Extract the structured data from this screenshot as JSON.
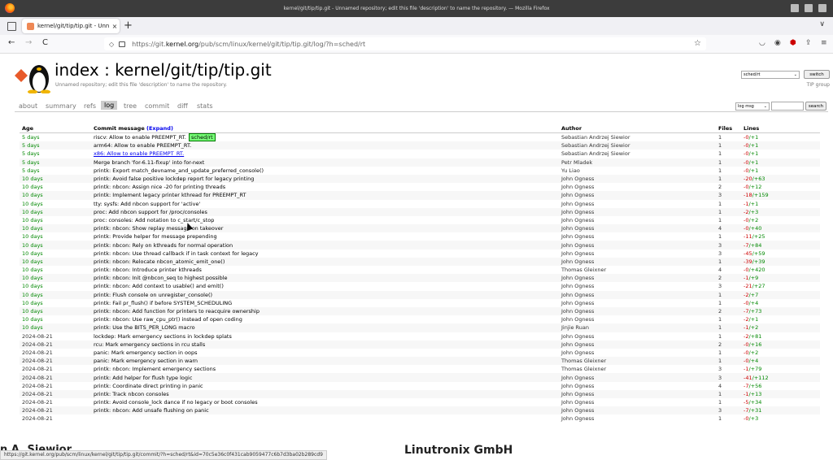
{
  "window": {
    "title": "kernel/git/tip/tip.git - Unnamed repository; edit this file 'description' to name the repository. — Mozilla Firefox"
  },
  "tab": {
    "title": "kernel/git/tip/tip.git - Unn",
    "close": "×",
    "new": "+"
  },
  "nav": {
    "back": "←",
    "forward": "→",
    "reload": "C",
    "url_prefix": "https://git.",
    "url_host": "kernel.org",
    "url_path": "/pub/scm/linux/kernel/git/tip/tip.git/log/?h=sched/rt",
    "bookmark": "☆"
  },
  "repo": {
    "title": "index : kernel/git/tip/tip.git",
    "description": "Unnamed repository; edit this file 'description' to name the repository.",
    "branch": "sched/rt",
    "switch_label": "switch",
    "group": "TIP group"
  },
  "tabs": [
    "about",
    "summary",
    "refs",
    "log",
    "tree",
    "commit",
    "diff",
    "stats"
  ],
  "active_tab": "log",
  "search": {
    "mode": "log msg",
    "button": "search"
  },
  "table": {
    "headers": {
      "age": "Age",
      "message": "Commit message",
      "expand": "(Expand)",
      "author": "Author",
      "files": "Files",
      "lines": "Lines"
    },
    "rows": [
      {
        "age": "5 days",
        "msg": "riscv: Allow to enable PREEMPT_RT.",
        "badge": "sched/rt",
        "author": "Sebastian Andrzej Siewior",
        "files": "1",
        "del": "-0",
        "add": "/+1"
      },
      {
        "age": "5 days",
        "msg": "arm64: Allow to enable PREEMPT_RT.",
        "author": "Sebastian Andrzej Siewior",
        "files": "1",
        "del": "-0",
        "add": "/+1"
      },
      {
        "age": "5 days",
        "msg": "x86: Allow to enable PREEMPT_RT.",
        "hl": true,
        "author": "Sebastian Andrzej Siewior",
        "files": "1",
        "del": "-0",
        "add": "/+1"
      },
      {
        "age": "5 days",
        "msg": "Merge branch 'for-6.11-fixup' into for-next",
        "author": "Petr Mladek",
        "files": "1",
        "del": "-0",
        "add": "/+1"
      },
      {
        "age": "5 days",
        "msg": "printk: Export match_devname_and_update_preferred_console()",
        "author": "Yu Liao",
        "files": "1",
        "del": "-0",
        "add": "/+1"
      },
      {
        "age": "10 days",
        "msg": "printk: Avoid false positive lockdep report for legacy printing",
        "author": "John Ogness",
        "files": "1",
        "del": "-20",
        "add": "/+63"
      },
      {
        "age": "10 days",
        "msg": "printk: nbcon: Assign nice -20 for printing threads",
        "author": "John Ogness",
        "files": "2",
        "del": "-0",
        "add": "/+12"
      },
      {
        "age": "10 days",
        "msg": "printk: Implement legacy printer kthread for PREEMPT_RT",
        "author": "John Ogness",
        "files": "3",
        "del": "-18",
        "add": "/+159"
      },
      {
        "age": "10 days",
        "msg": "tty: sysfs: Add nbcon support for 'active'",
        "author": "John Ogness",
        "files": "1",
        "del": "-1",
        "add": "/+1"
      },
      {
        "age": "10 days",
        "msg": "proc: Add nbcon support for /proc/consoles",
        "author": "John Ogness",
        "files": "1",
        "del": "-2",
        "add": "/+3"
      },
      {
        "age": "10 days",
        "msg": "proc: consoles: Add notation to c_start/c_stop",
        "author": "John Ogness",
        "files": "1",
        "del": "-0",
        "add": "/+2"
      },
      {
        "age": "10 days",
        "msg": "printk: nbcon: Show replay message on takeover",
        "author": "John Ogness",
        "files": "4",
        "del": "-0",
        "add": "/+40"
      },
      {
        "age": "10 days",
        "msg": "printk: Provide helper for message prepending",
        "author": "John Ogness",
        "files": "1",
        "del": "-11",
        "add": "/+25"
      },
      {
        "age": "10 days",
        "msg": "printk: nbcon: Rely on kthreads for normal operation",
        "author": "John Ogness",
        "files": "3",
        "del": "-7",
        "add": "/+84"
      },
      {
        "age": "10 days",
        "msg": "printk: nbcon: Use thread callback if in task context for legacy",
        "author": "John Ogness",
        "files": "3",
        "del": "-45",
        "add": "/+59"
      },
      {
        "age": "10 days",
        "msg": "printk: nbcon: Relocate nbcon_atomic_emit_one()",
        "author": "John Ogness",
        "files": "1",
        "del": "-39",
        "add": "/+39"
      },
      {
        "age": "10 days",
        "msg": "printk: nbcon: Introduce printer kthreads",
        "author": "Thomas Gleixner",
        "files": "4",
        "del": "-0",
        "add": "/+420"
      },
      {
        "age": "10 days",
        "msg": "printk: nbcon: Init @nbcon_seq to highest possible",
        "author": "John Ogness",
        "files": "2",
        "del": "-1",
        "add": "/+9"
      },
      {
        "age": "10 days",
        "msg": "printk: nbcon: Add context to usable() and emit()",
        "author": "John Ogness",
        "files": "3",
        "del": "-21",
        "add": "/+27"
      },
      {
        "age": "10 days",
        "msg": "printk: Flush console on unregister_console()",
        "author": "John Ogness",
        "files": "1",
        "del": "-2",
        "add": "/+7"
      },
      {
        "age": "10 days",
        "msg": "printk: Fail pr_flush() if before SYSTEM_SCHEDULING",
        "author": "John Ogness",
        "files": "1",
        "del": "-0",
        "add": "/+4"
      },
      {
        "age": "10 days",
        "msg": "printk: nbcon: Add function for printers to reacquire ownership",
        "author": "John Ogness",
        "files": "2",
        "del": "-7",
        "add": "/+73"
      },
      {
        "age": "10 days",
        "msg": "printk: nbcon: Use raw_cpu_ptr() instead of open coding",
        "author": "John Ogness",
        "files": "1",
        "del": "-2",
        "add": "/+1"
      },
      {
        "age": "10 days",
        "msg": "printk: Use the BITS_PER_LONG macro",
        "author": "Jinjie Ruan",
        "files": "1",
        "del": "-1",
        "add": "/+2"
      },
      {
        "age": "2024-08-21",
        "old": true,
        "msg": "lockdep: Mark emergency sections in lockdep splats",
        "author": "John Ogness",
        "files": "1",
        "del": "-2",
        "add": "/+81"
      },
      {
        "age": "2024-08-21",
        "old": true,
        "msg": "rcu: Mark emergency sections in rcu stalls",
        "author": "John Ogness",
        "files": "2",
        "del": "-0",
        "add": "/+16"
      },
      {
        "age": "2024-08-21",
        "old": true,
        "msg": "panic: Mark emergency section in oops",
        "author": "John Ogness",
        "files": "1",
        "del": "-0",
        "add": "/+2"
      },
      {
        "age": "2024-08-21",
        "old": true,
        "msg": "panic: Mark emergency section in warn",
        "author": "Thomas Gleixner",
        "files": "1",
        "del": "-0",
        "add": "/+4"
      },
      {
        "age": "2024-08-21",
        "old": true,
        "msg": "printk: nbcon: Implement emergency sections",
        "author": "Thomas Gleixner",
        "files": "3",
        "del": "-1",
        "add": "/+79"
      },
      {
        "age": "2024-08-21",
        "old": true,
        "msg": "printk: Add helper for flush type logic",
        "author": "John Ogness",
        "files": "3",
        "del": "-41",
        "add": "/+112"
      },
      {
        "age": "2024-08-21",
        "old": true,
        "msg": "printk: Coordinate direct printing in panic",
        "author": "John Ogness",
        "files": "4",
        "del": "-7",
        "add": "/+56"
      },
      {
        "age": "2024-08-21",
        "old": true,
        "msg": "printk: Track nbcon consoles",
        "author": "John Ogness",
        "files": "1",
        "del": "-1",
        "add": "/+13"
      },
      {
        "age": "2024-08-21",
        "old": true,
        "msg": "printk: Avoid console_lock dance if no legacy or boot consoles",
        "author": "John Ogness",
        "files": "1",
        "del": "-5",
        "add": "/+34"
      },
      {
        "age": "2024-08-21",
        "old": true,
        "msg": "printk: nbcon: Add unsafe flushing on panic",
        "author": "John Ogness",
        "files": "3",
        "del": "-7",
        "add": "/+31"
      },
      {
        "age": "2024-08-21",
        "old": true,
        "msg": "",
        "author": "John Ogness",
        "files": "1",
        "del": "-0",
        "add": "/+3"
      }
    ]
  },
  "status_url": "https://git.kernel.org/pub/scm/linux/kernel/git/tip/tip.git/commit/?h=sched/rt&id=70c5e36c0f431cab9059477c6b7d3ba02b289cd9",
  "overlay": {
    "left": "n A. Siewior",
    "center": "Linutronix GmbH"
  }
}
